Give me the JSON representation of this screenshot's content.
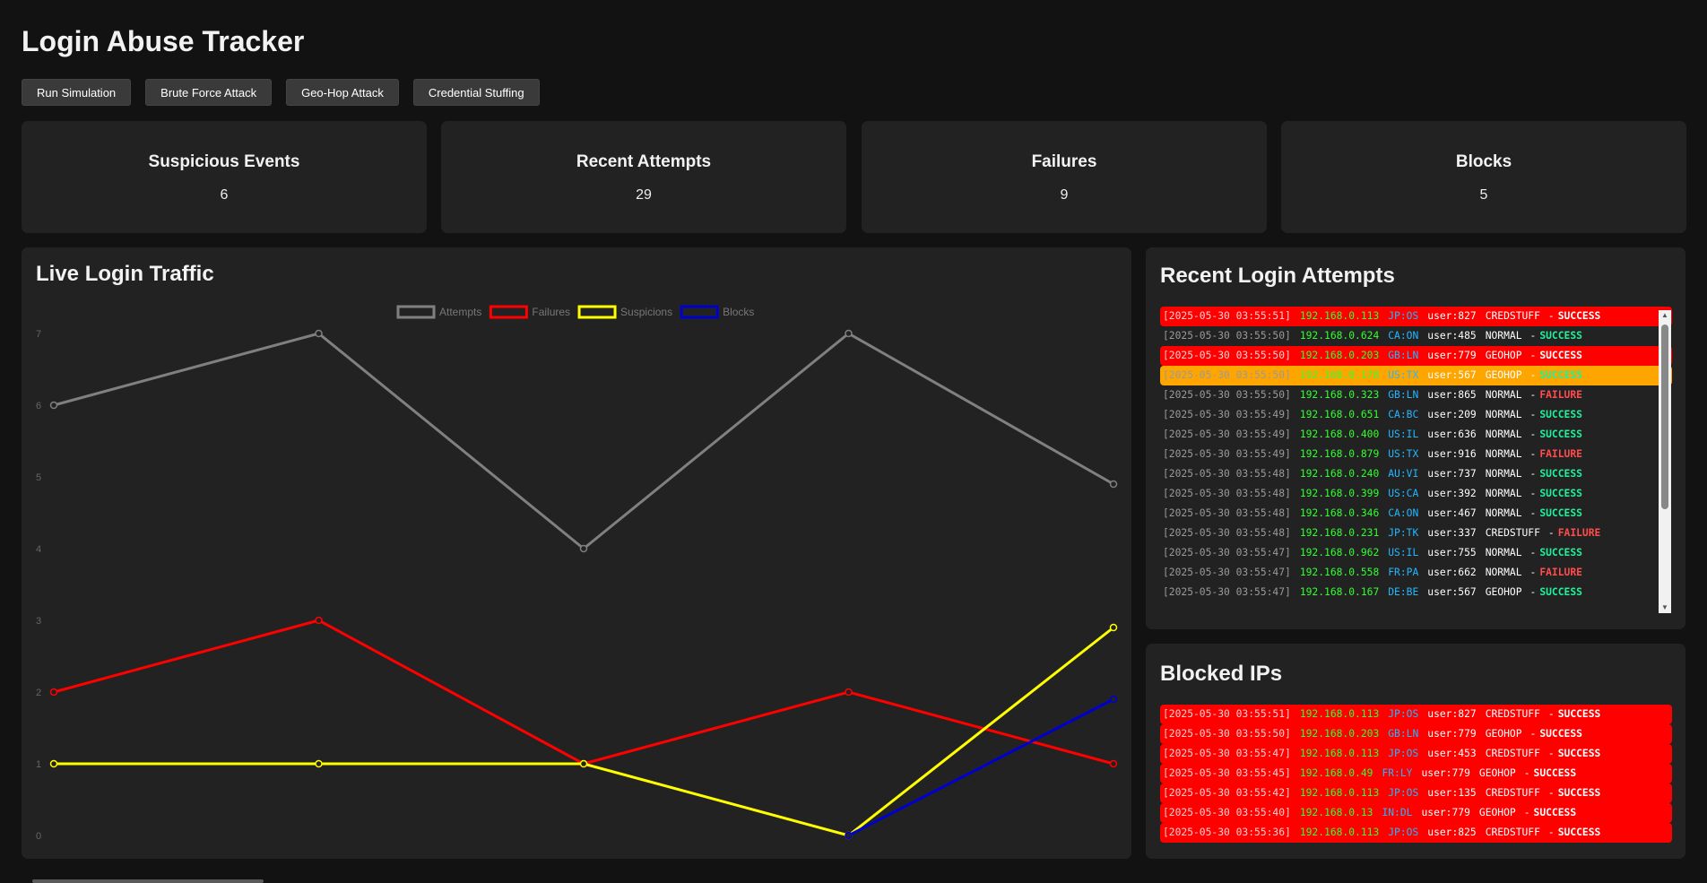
{
  "page_title": "Login Abuse Tracker",
  "toolbar": {
    "buttons": [
      "Run Simulation",
      "Brute Force Attack",
      "Geo-Hop Attack",
      "Credential Stuffing"
    ]
  },
  "stats": [
    {
      "title": "Suspicious Events",
      "value": "6"
    },
    {
      "title": "Recent Attempts",
      "value": "29"
    },
    {
      "title": "Failures",
      "value": "9"
    },
    {
      "title": "Blocks",
      "value": "5"
    }
  ],
  "traffic_panel": {
    "title": "Live Login Traffic"
  },
  "chart_data": {
    "type": "line",
    "title": "",
    "xlabel": "",
    "ylabel": "",
    "x": [
      1,
      2,
      3,
      4,
      5
    ],
    "ylim": [
      0,
      7
    ],
    "yticks": [
      "0",
      "1",
      "2",
      "3",
      "4",
      "5",
      "6",
      "7"
    ],
    "grid": false,
    "legend": "top-center",
    "series": [
      {
        "name": "Attempts",
        "color": "#808080",
        "values": [
          6,
          7,
          4,
          7,
          4.9
        ]
      },
      {
        "name": "Failures",
        "color": "#ff0000",
        "values": [
          2,
          3,
          1,
          2,
          1
        ]
      },
      {
        "name": "Suspicions",
        "color": "#ffff00",
        "values": [
          1,
          1,
          1,
          0,
          2.9
        ]
      },
      {
        "name": "Blocks",
        "color": "#0000cd",
        "values": [
          null,
          null,
          null,
          0,
          1.9
        ]
      }
    ]
  },
  "recent_panel": {
    "title": "Recent Login Attempts",
    "rows": [
      {
        "ts": "[2025-05-30 03:55:51]",
        "ip": "192.168.0.113",
        "geo": "JP:OS",
        "user": "user:827",
        "type": "CREDSTUFF",
        "sep": "-",
        "status": "SUCCESS",
        "hl": "red"
      },
      {
        "ts": "[2025-05-30 03:55:50]",
        "ip": "192.168.0.624",
        "geo": "CA:ON",
        "user": "user:485",
        "type": "NORMAL",
        "sep": "-",
        "status": "SUCCESS",
        "hl": ""
      },
      {
        "ts": "[2025-05-30 03:55:50]",
        "ip": "192.168.0.203",
        "geo": "GB:LN",
        "user": "user:779",
        "type": "GEOHOP",
        "sep": "-",
        "status": "SUCCESS",
        "hl": "red"
      },
      {
        "ts": "[2025-05-30 03:55:50]",
        "ip": "192.168.0.178",
        "geo": "US:TX",
        "user": "user:567",
        "type": "GEOHOP",
        "sep": "-",
        "status": "SUCCESS",
        "hl": "orange"
      },
      {
        "ts": "[2025-05-30 03:55:50]",
        "ip": "192.168.0.323",
        "geo": "GB:LN",
        "user": "user:865",
        "type": "NORMAL",
        "sep": "-",
        "status": "FAILURE",
        "hl": ""
      },
      {
        "ts": "[2025-05-30 03:55:49]",
        "ip": "192.168.0.651",
        "geo": "CA:BC",
        "user": "user:209",
        "type": "NORMAL",
        "sep": "-",
        "status": "SUCCESS",
        "hl": ""
      },
      {
        "ts": "[2025-05-30 03:55:49]",
        "ip": "192.168.0.400",
        "geo": "US:IL",
        "user": "user:636",
        "type": "NORMAL",
        "sep": "-",
        "status": "SUCCESS",
        "hl": ""
      },
      {
        "ts": "[2025-05-30 03:55:49]",
        "ip": "192.168.0.879",
        "geo": "US:TX",
        "user": "user:916",
        "type": "NORMAL",
        "sep": "-",
        "status": "FAILURE",
        "hl": ""
      },
      {
        "ts": "[2025-05-30 03:55:48]",
        "ip": "192.168.0.240",
        "geo": "AU:VI",
        "user": "user:737",
        "type": "NORMAL",
        "sep": "-",
        "status": "SUCCESS",
        "hl": ""
      },
      {
        "ts": "[2025-05-30 03:55:48]",
        "ip": "192.168.0.399",
        "geo": "US:CA",
        "user": "user:392",
        "type": "NORMAL",
        "sep": "-",
        "status": "SUCCESS",
        "hl": ""
      },
      {
        "ts": "[2025-05-30 03:55:48]",
        "ip": "192.168.0.346",
        "geo": "CA:ON",
        "user": "user:467",
        "type": "NORMAL",
        "sep": "-",
        "status": "SUCCESS",
        "hl": ""
      },
      {
        "ts": "[2025-05-30 03:55:48]",
        "ip": "192.168.0.231",
        "geo": "JP:TK",
        "user": "user:337",
        "type": "CREDSTUFF",
        "sep": "-",
        "status": "FAILURE",
        "hl": ""
      },
      {
        "ts": "[2025-05-30 03:55:47]",
        "ip": "192.168.0.962",
        "geo": "US:IL",
        "user": "user:755",
        "type": "NORMAL",
        "sep": "-",
        "status": "SUCCESS",
        "hl": ""
      },
      {
        "ts": "[2025-05-30 03:55:47]",
        "ip": "192.168.0.558",
        "geo": "FR:PA",
        "user": "user:662",
        "type": "NORMAL",
        "sep": "-",
        "status": "FAILURE",
        "hl": ""
      },
      {
        "ts": "[2025-05-30 03:55:47]",
        "ip": "192.168.0.167",
        "geo": "DE:BE",
        "user": "user:567",
        "type": "GEOHOP",
        "sep": "-",
        "status": "SUCCESS",
        "hl": ""
      }
    ]
  },
  "blocked_panel": {
    "title": "Blocked IPs",
    "rows": [
      {
        "ts": "[2025-05-30 03:55:51]",
        "ip": "192.168.0.113",
        "geo": "JP:OS",
        "user": "user:827",
        "type": "CREDSTUFF",
        "sep": "-",
        "status": "SUCCESS",
        "hl": "red"
      },
      {
        "ts": "[2025-05-30 03:55:50]",
        "ip": "192.168.0.203",
        "geo": "GB:LN",
        "user": "user:779",
        "type": "GEOHOP",
        "sep": "-",
        "status": "SUCCESS",
        "hl": "red"
      },
      {
        "ts": "[2025-05-30 03:55:47]",
        "ip": "192.168.0.113",
        "geo": "JP:OS",
        "user": "user:453",
        "type": "CREDSTUFF",
        "sep": "-",
        "status": "SUCCESS",
        "hl": "red"
      },
      {
        "ts": "[2025-05-30 03:55:45]",
        "ip": "192.168.0.49",
        "geo": "FR:LY",
        "user": "user:779",
        "type": "GEOHOP",
        "sep": "-",
        "status": "SUCCESS",
        "hl": "red"
      },
      {
        "ts": "[2025-05-30 03:55:42]",
        "ip": "192.168.0.113",
        "geo": "JP:OS",
        "user": "user:135",
        "type": "CREDSTUFF",
        "sep": "-",
        "status": "SUCCESS",
        "hl": "red"
      },
      {
        "ts": "[2025-05-30 03:55:40]",
        "ip": "192.168.0.13",
        "geo": "IN:DL",
        "user": "user:779",
        "type": "GEOHOP",
        "sep": "-",
        "status": "SUCCESS",
        "hl": "red"
      },
      {
        "ts": "[2025-05-30 03:55:36]",
        "ip": "192.168.0.113",
        "geo": "JP:OS",
        "user": "user:825",
        "type": "CREDSTUFF",
        "sep": "-",
        "status": "SUCCESS",
        "hl": "red"
      }
    ]
  }
}
